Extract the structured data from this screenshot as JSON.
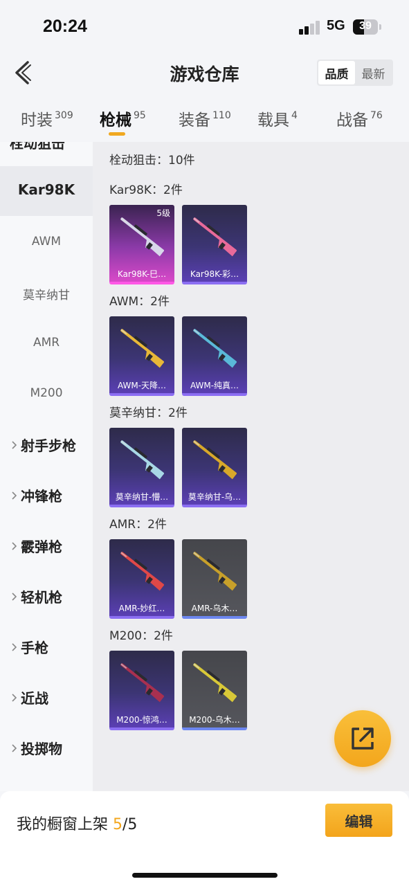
{
  "status": {
    "time": "20:24",
    "network": "5G",
    "battery": "39"
  },
  "header": {
    "title": "游戏仓库",
    "sort_options": [
      "品质",
      "最新"
    ],
    "sort_active": 0
  },
  "tabs": [
    {
      "label": "时装",
      "count": "309"
    },
    {
      "label": "枪械",
      "count": "95"
    },
    {
      "label": "装备",
      "count": "110"
    },
    {
      "label": "载具",
      "count": "4"
    },
    {
      "label": "战备",
      "count": "76"
    }
  ],
  "active_tab": 1,
  "sidebar": {
    "group": "栓动狙击",
    "items": [
      "Kar98K",
      "AWM",
      "莫辛纳甘",
      "AMR",
      "M200"
    ],
    "selected": 0,
    "categories": [
      "射手步枪",
      "冲锋枪",
      "霰弹枪",
      "轻机枪",
      "手枪",
      "近战",
      "投掷物"
    ]
  },
  "main": {
    "summary": "栓动狙击：10件",
    "sections": [
      {
        "title": "Kar98K：2件",
        "items": [
          {
            "name": "Kar98K-巳…",
            "level": "5级",
            "rarity": "pink",
            "color": "#d8d6ea"
          },
          {
            "name": "Kar98K-彩…",
            "rarity": "purple",
            "color": "#e86a9a"
          }
        ]
      },
      {
        "title": "AWM：2件",
        "items": [
          {
            "name": "AWM-天降…",
            "rarity": "purple",
            "color": "#e8b838"
          },
          {
            "name": "AWM-纯真…",
            "rarity": "purple",
            "color": "#5ab9d8"
          }
        ]
      },
      {
        "title": "莫辛纳甘：2件",
        "items": [
          {
            "name": "莫辛纳甘-懵…",
            "rarity": "purple",
            "color": "#a8d8e6"
          },
          {
            "name": "莫辛纳甘-乌…",
            "rarity": "purple",
            "color": "#d8a82a"
          }
        ]
      },
      {
        "title": "AMR：2件",
        "items": [
          {
            "name": "AMR-妙红…",
            "rarity": "purple",
            "color": "#e04848"
          },
          {
            "name": "AMR-乌木…",
            "rarity": "grey",
            "color": "#c8a02a"
          }
        ]
      },
      {
        "title": "M200：2件",
        "items": [
          {
            "name": "M200-惊鸿…",
            "rarity": "purple",
            "color": "#a83050"
          },
          {
            "name": "M200-乌木…",
            "rarity": "grey",
            "color": "#d8c838"
          }
        ]
      }
    ]
  },
  "bottom": {
    "label": "我的橱窗上架 ",
    "current": "5",
    "total": "/5",
    "edit_label": "编辑"
  },
  "colors": {
    "accent": "#f3a61c",
    "purple_border": "#8b6ef2",
    "pink_border": "#ff58e6"
  }
}
